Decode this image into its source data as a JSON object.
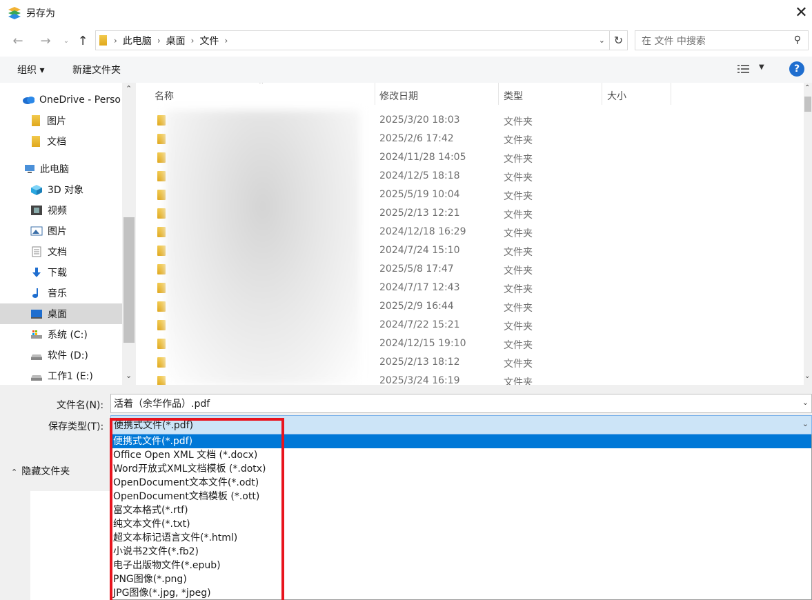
{
  "window": {
    "title": "另存为",
    "close_icon": "✕"
  },
  "address": {
    "crumbs": [
      "此电脑",
      "桌面",
      "文件"
    ]
  },
  "search": {
    "placeholder": "在 文件 中搜索"
  },
  "toolbar": {
    "organize": "组织 ▾",
    "new_folder": "新建文件夹",
    "help": "?"
  },
  "nav": {
    "items": [
      {
        "label": "OneDrive - Perso",
        "icon": "onedrive-icon",
        "color": "#1f6ecf"
      },
      {
        "label": "图片",
        "icon": "folder-icon",
        "color": "#f2c94c"
      },
      {
        "label": "文档",
        "icon": "folder-icon",
        "color": "#f2c94c"
      },
      {
        "label": "此电脑",
        "icon": "computer-icon",
        "color": "#4a90d9"
      },
      {
        "label": "3D 对象",
        "icon": "cube-3d-icon",
        "color": "#2aa7e0"
      },
      {
        "label": "视频",
        "icon": "video-icon",
        "color": "#444444"
      },
      {
        "label": "图片",
        "icon": "pictures-icon",
        "color": "#3b6fa8"
      },
      {
        "label": "文档",
        "icon": "document-icon",
        "color": "#888888"
      },
      {
        "label": "下载",
        "icon": "download-icon",
        "color": "#1f6ecf"
      },
      {
        "label": "音乐",
        "icon": "music-icon",
        "color": "#1f6ecf"
      },
      {
        "label": "桌面",
        "icon": "desktop-icon",
        "color": "#1f6ecf"
      },
      {
        "label": "系统 (C:)",
        "icon": "drive-c-icon",
        "color": "#888888"
      },
      {
        "label": "软件 (D:)",
        "icon": "drive-icon",
        "color": "#888888"
      },
      {
        "label": "工作1 (E:)",
        "icon": "drive-icon",
        "color": "#888888"
      }
    ]
  },
  "files": {
    "columns": [
      "名称",
      "修改日期",
      "类型",
      "大小"
    ],
    "rows": [
      {
        "date": "2025/3/20 18:03",
        "type": "文件夹"
      },
      {
        "date": "2025/2/6 17:42",
        "type": "文件夹"
      },
      {
        "date": "2024/11/28 14:05",
        "type": "文件夹"
      },
      {
        "date": "2024/12/5 18:18",
        "type": "文件夹"
      },
      {
        "date": "2025/5/19 10:04",
        "type": "文件夹"
      },
      {
        "date": "2025/2/13 12:21",
        "type": "文件夹"
      },
      {
        "date": "2024/12/18 16:29",
        "type": "文件夹"
      },
      {
        "date": "2024/7/24 15:10",
        "type": "文件夹"
      },
      {
        "date": "2025/5/8 17:47",
        "type": "文件夹"
      },
      {
        "date": "2024/7/17 12:43",
        "type": "文件夹"
      },
      {
        "date": "2025/2/9 16:44",
        "type": "文件夹"
      },
      {
        "date": "2024/7/22 15:21",
        "type": "文件夹"
      },
      {
        "date": "2024/12/15 19:10",
        "type": "文件夹"
      },
      {
        "date": "2025/2/13 18:12",
        "type": "文件夹"
      },
      {
        "date": "2025/3/24 16:19",
        "type": "文件夹"
      }
    ]
  },
  "save": {
    "filename_label": "文件名(N):",
    "filename_value": "活着（余华作品）.pdf",
    "type_label": "保存类型(T):",
    "type_value": "便携式文件(*.pdf)",
    "hide_folders": "隐藏文件夹",
    "options": [
      "便携式文件(*.pdf)",
      "Office Open XML 文档 (*.docx)",
      "Word开放式XML文档模板 (*.dotx)",
      "OpenDocument文本文件(*.odt)",
      "OpenDocument文档模板 (*.ott)",
      "富文本格式(*.rtf)",
      "纯文本文件(*.txt)",
      "超文本标记语言文件(*.html)",
      "小说书2文件(*.fb2)",
      "电子出版物文件(*.epub)",
      "PNG图像(*.png)",
      "JPG图像(*.jpg, *jpeg)"
    ]
  },
  "colors": {
    "accent": "#0078d7",
    "highlight_border": "#e8141e",
    "selected_bg": "#cce4f7"
  }
}
